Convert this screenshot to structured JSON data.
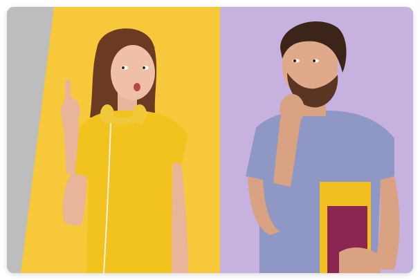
{
  "image": {
    "subject": "photo-card",
    "colors": {
      "left_gray": "#bdbdbd",
      "yellow": "#f6c83a",
      "purple": "#c7b1df",
      "shirt_yellow": "#f2c21f",
      "shirt_blue": "#8f97c4",
      "skin": "#e8b49a",
      "hair_dark": "#4a2e22",
      "book_magenta": "#8b2650",
      "book_yellow": "#f1bf20"
    }
  }
}
